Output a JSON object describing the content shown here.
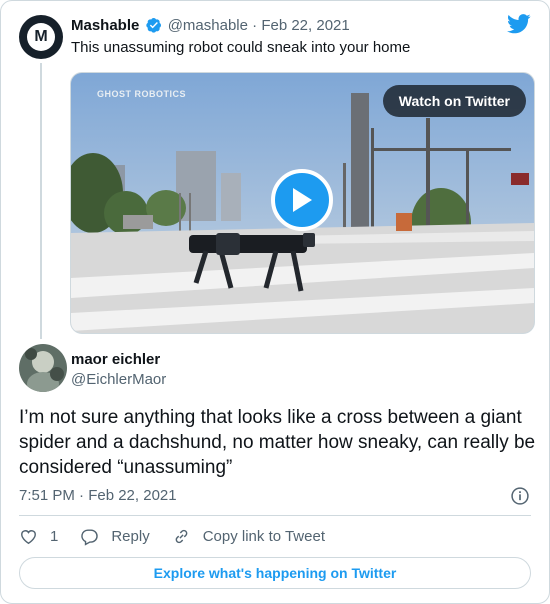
{
  "quoted_tweet": {
    "author_name": "Mashable",
    "author_handle": "@mashable",
    "separator": " · ",
    "date": "Feb 22, 2021",
    "text": "This unassuming robot could sneak into your home",
    "avatar_letter": "M",
    "media": {
      "brand_overlay": "GHOST ROBOTICS",
      "watch_button": "Watch on Twitter"
    }
  },
  "tweet": {
    "author_name": "maor eichler",
    "author_handle": "@EichlerMaor",
    "text": "I’m not sure anything that looks like a cross between a giant spider and a dachshund, no matter how sneaky, can really be considered “unassuming”",
    "timestamp": "7:51 PM · Feb 22, 2021"
  },
  "actions": {
    "like_count": "1",
    "reply_label": "Reply",
    "copy_link_label": "Copy link to Tweet"
  },
  "footer": {
    "explore_label": "Explore what's happening on Twitter"
  },
  "colors": {
    "accent": "#1d9bf0",
    "text": "#0f1419",
    "secondary": "#536471",
    "border": "#cfd9de"
  },
  "icons": [
    "twitter-bird-icon",
    "verified-badge-icon",
    "play-icon",
    "info-icon",
    "heart-icon",
    "reply-icon",
    "link-icon"
  ]
}
